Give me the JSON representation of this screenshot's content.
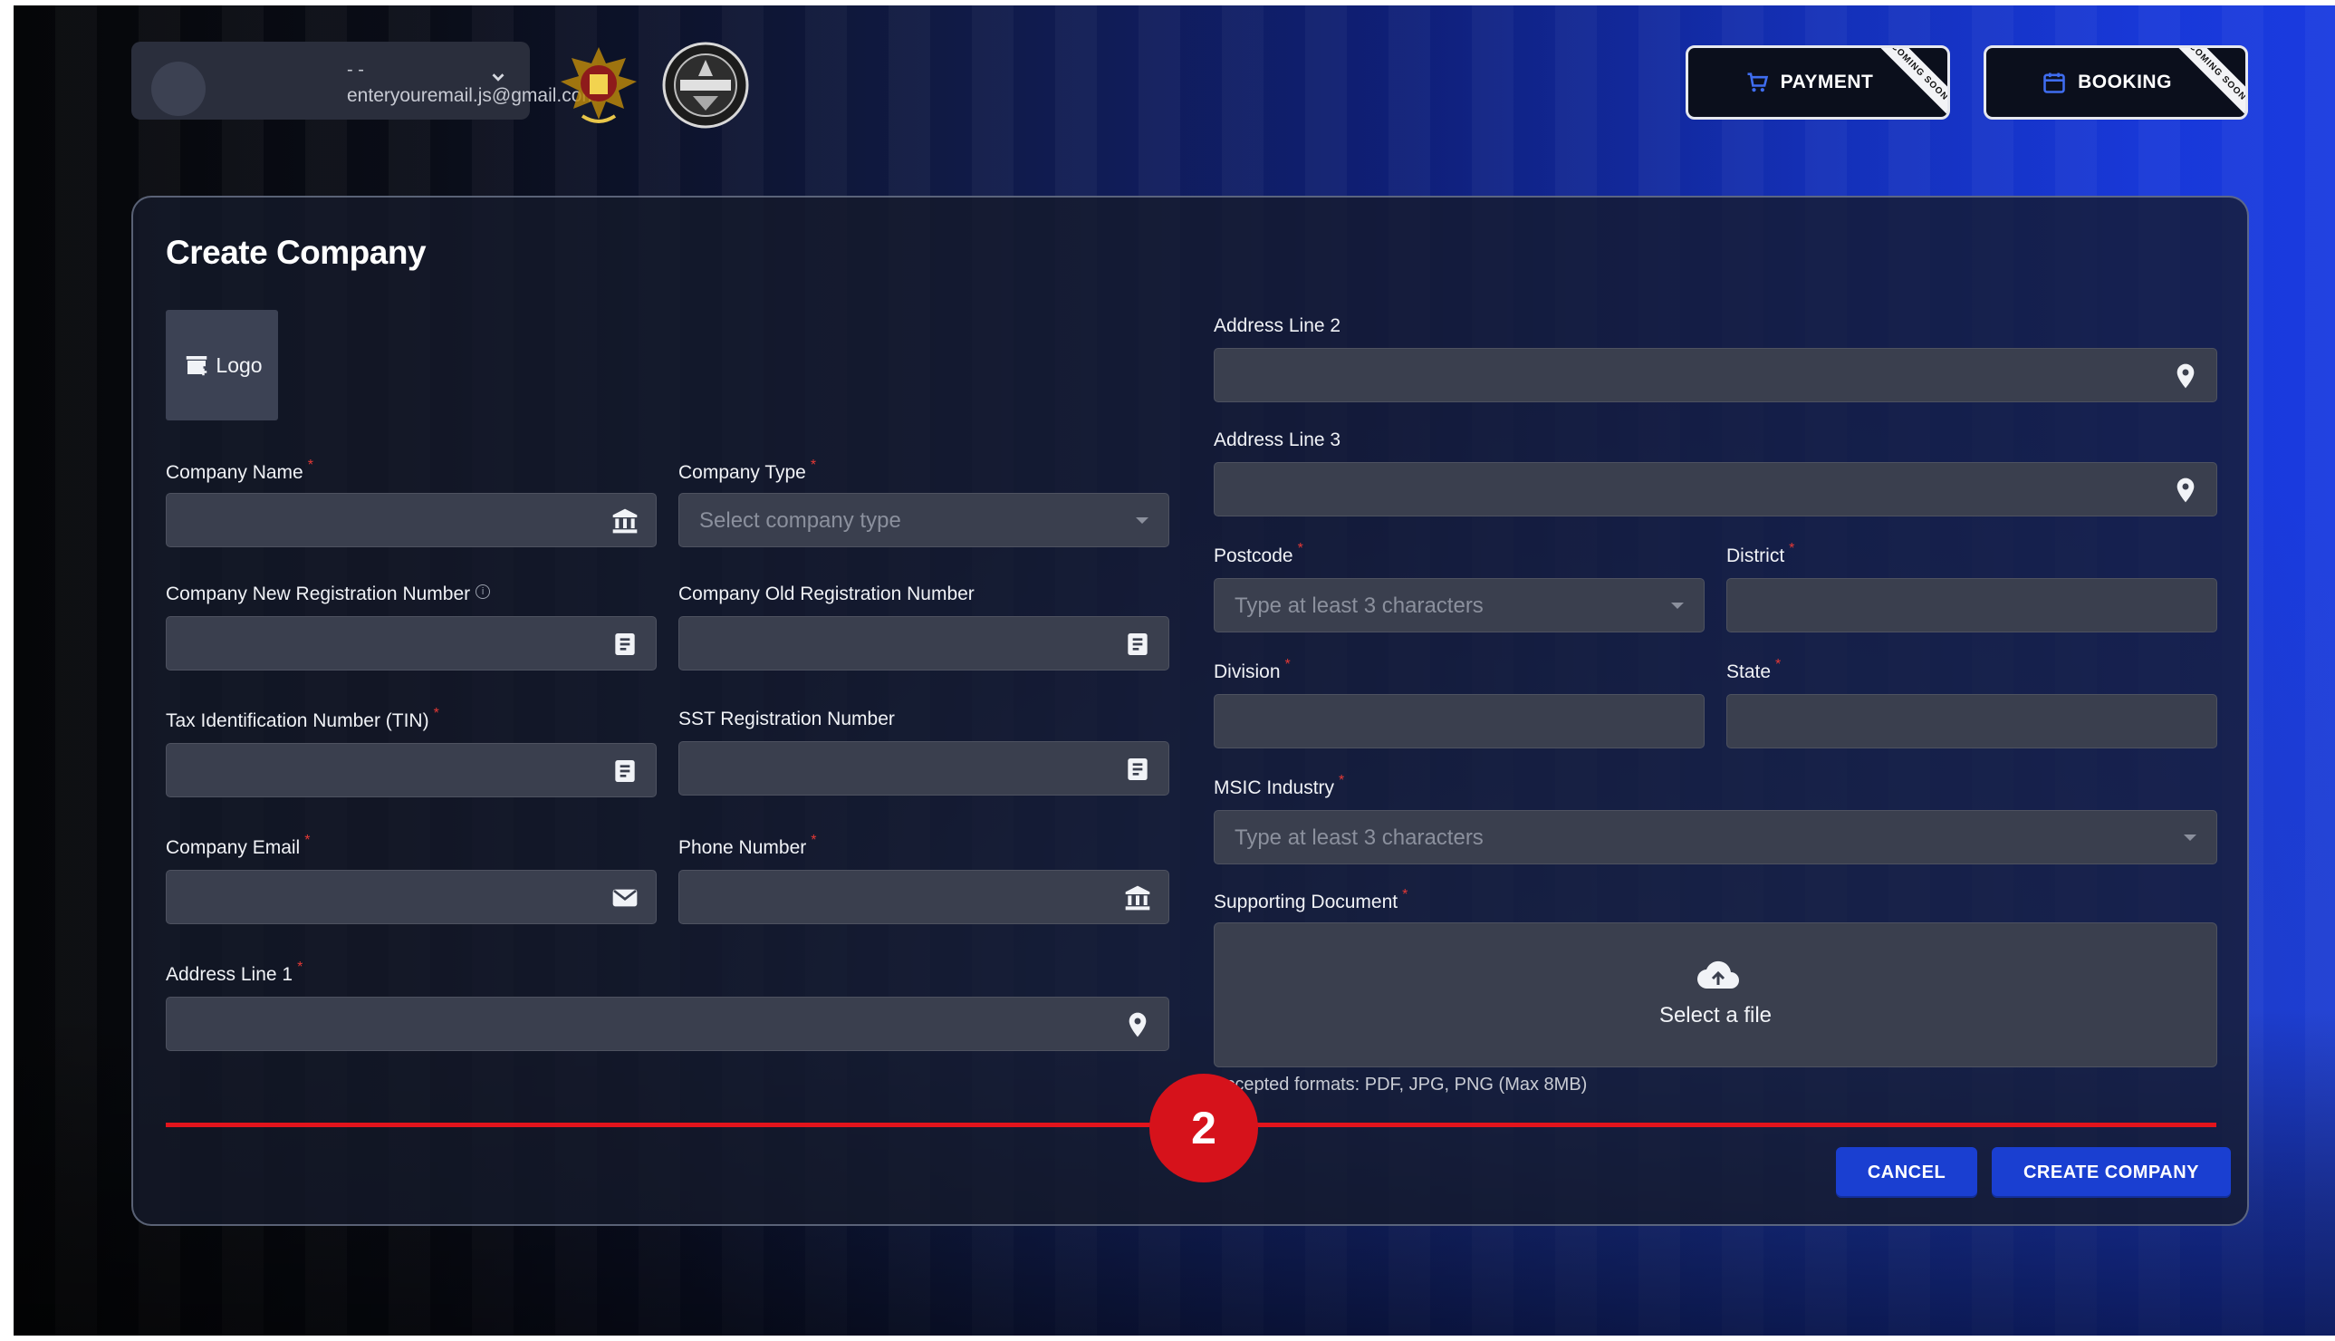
{
  "header": {
    "user_name": "- -",
    "user_email": "enteryouremail.js@gmail.com",
    "payment_label": "PAYMENT",
    "booking_label": "BOOKING",
    "coming_soon": "COMING SOON"
  },
  "form": {
    "title": "Create Company",
    "logo_label": "Logo",
    "company_name": {
      "label": "Company Name",
      "value": ""
    },
    "company_type": {
      "label": "Company Type",
      "placeholder": "Select company type"
    },
    "new_reg": {
      "label": "Company New Registration Number",
      "value": ""
    },
    "old_reg": {
      "label": "Company Old Registration Number",
      "value": ""
    },
    "tin": {
      "label": "Tax Identification Number (TIN)",
      "value": ""
    },
    "sst": {
      "label": "SST Registration Number",
      "value": ""
    },
    "company_email": {
      "label": "Company Email",
      "value": ""
    },
    "phone": {
      "label": "Phone Number",
      "value": ""
    },
    "address1": {
      "label": "Address Line 1",
      "value": ""
    },
    "address2": {
      "label": "Address Line 2",
      "value": ""
    },
    "address3": {
      "label": "Address Line 3",
      "value": ""
    },
    "postcode": {
      "label": "Postcode",
      "placeholder": "Type at least 3 characters"
    },
    "district": {
      "label": "District",
      "value": ""
    },
    "division": {
      "label": "Division",
      "value": ""
    },
    "state": {
      "label": "State",
      "value": ""
    },
    "msic": {
      "label": "MSIC Industry",
      "placeholder": "Type at least 3 characters"
    },
    "supporting_doc": {
      "label": "Supporting Document",
      "select_label": "Select a file",
      "accepted": "Accepted formats: PDF, JPG, PNG (Max 8MB)"
    },
    "cancel_label": "CANCEL",
    "create_label": "CREATE COMPANY"
  },
  "annotation": {
    "step": "2",
    "color": "#d6121b"
  },
  "colors": {
    "accent": "#1a3fd1",
    "required": "#e53935",
    "field_bg": "#3a3f4e"
  },
  "icons": [
    "chevron-down-icon",
    "cart-icon",
    "calendar-icon",
    "store-add-icon",
    "bank-icon",
    "document-icon",
    "mail-icon",
    "location-pin-icon",
    "cloud-upload-icon",
    "info-icon"
  ]
}
